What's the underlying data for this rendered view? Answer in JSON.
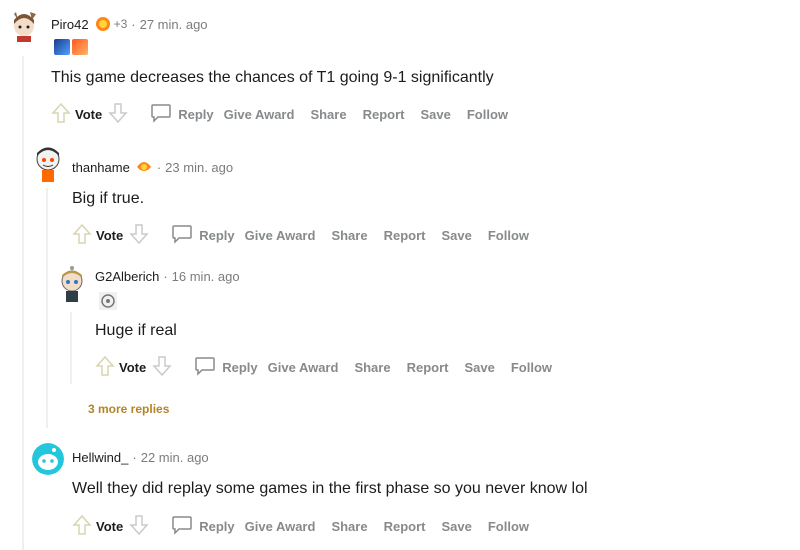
{
  "comments": [
    {
      "username": "Piro42",
      "award_count": "+3",
      "time": "27 min. ago",
      "body": "This game decreases the chances of T1 going 9-1 significantly",
      "actions": {
        "vote": "Vote",
        "reply": "Reply",
        "give_award": "Give Award",
        "share": "Share",
        "report": "Report",
        "save": "Save",
        "follow": "Follow"
      }
    },
    {
      "username": "thanhame",
      "time": "23 min. ago",
      "body": "Big if true.",
      "actions": {
        "vote": "Vote",
        "reply": "Reply",
        "give_award": "Give Award",
        "share": "Share",
        "report": "Report",
        "save": "Save",
        "follow": "Follow"
      }
    },
    {
      "username": "G2Alberich",
      "time": "16 min. ago",
      "body": "Huge if real",
      "actions": {
        "vote": "Vote",
        "reply": "Reply",
        "give_award": "Give Award",
        "share": "Share",
        "report": "Report",
        "save": "Save",
        "follow": "Follow"
      }
    },
    {
      "username": "Hellwind_",
      "time": "22 min. ago",
      "body": "Well they did replay some games in the first phase so you never know lol",
      "actions": {
        "vote": "Vote",
        "reply": "Reply",
        "give_award": "Give Award",
        "share": "Share",
        "report": "Report",
        "save": "Save",
        "follow": "Follow"
      }
    }
  ],
  "more_replies": "3 more replies",
  "colors": {
    "text": "#1c1c1c",
    "muted": "#878a8c",
    "thread_line": "#edeff1",
    "more_replies": "#b3852a",
    "vote_arrow": "#d7d5b0"
  },
  "icons": [
    "upvote-arrow-icon",
    "downvote-arrow-icon",
    "comment-reply-icon",
    "award-icon",
    "flair-icon"
  ]
}
